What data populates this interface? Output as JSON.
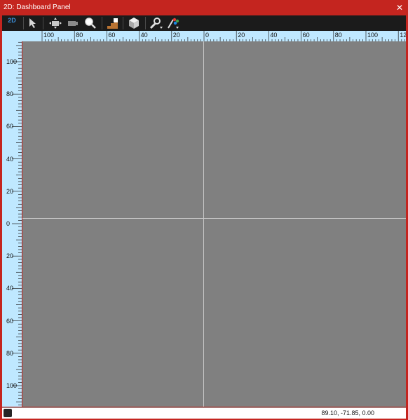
{
  "window": {
    "title": "2D: Dashboard Panel",
    "close_glyph": "✕"
  },
  "toolbar": {
    "mode_label": "2D",
    "tools": [
      {
        "name": "select-arrow-icon"
      },
      {
        "name": "pan-camera-icon"
      },
      {
        "name": "move-camera-icon"
      },
      {
        "name": "zoom-magnifier-icon"
      },
      {
        "name": "stairs-icon"
      },
      {
        "name": "cube-icon"
      },
      {
        "name": "wrench-dropdown-icon"
      },
      {
        "name": "paint-brush-dropdown-icon"
      }
    ]
  },
  "ruler_top": {
    "labels": [
      "100",
      "80",
      "60",
      "40",
      "20",
      "0",
      "20",
      "40",
      "60",
      "80",
      "100",
      "12"
    ]
  },
  "ruler_left": {
    "labels": [
      "100",
      "80",
      "60",
      "40",
      "20",
      "0",
      "20",
      "40",
      "60",
      "80",
      "100"
    ]
  },
  "status": {
    "coordinates": "89.10, -71.85, 0.00"
  },
  "colors": {
    "window_frame": "#c4251f",
    "toolbar_bg": "#1b1b1b",
    "ruler_bg": "#bfe8ff",
    "canvas_bg": "#808080",
    "axis_line": "#c8c8c8",
    "mode_label": "#3b8fd9"
  }
}
